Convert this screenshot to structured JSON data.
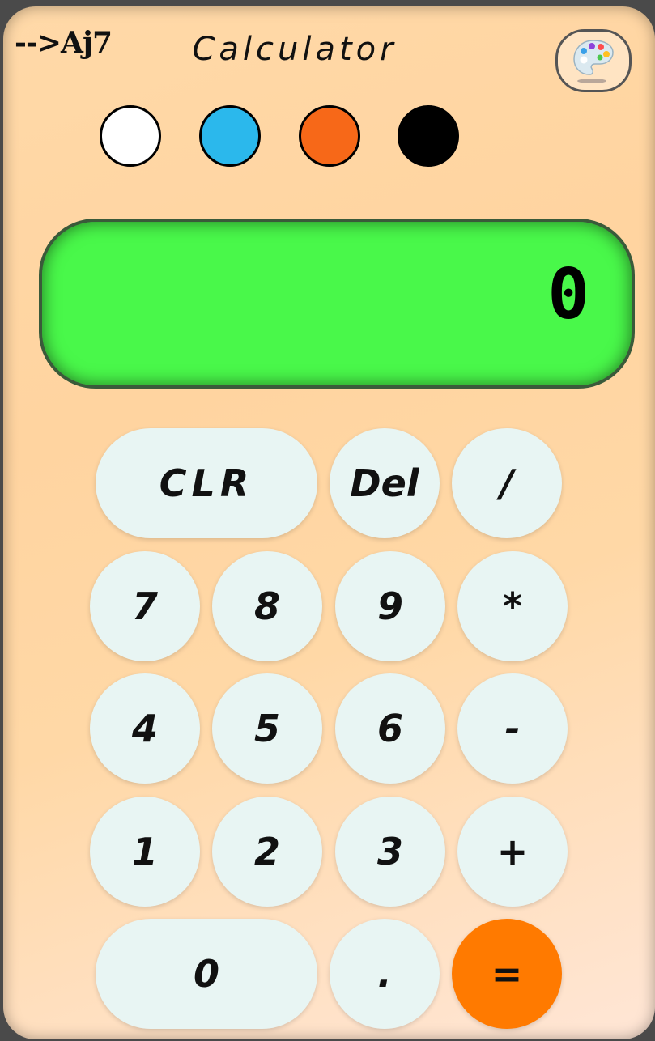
{
  "header": {
    "brand": "-->Aj7",
    "title": "Calculator",
    "palette_icon": "palette-icon"
  },
  "theme_swatches": [
    {
      "name": "white",
      "color": "#ffffff"
    },
    {
      "name": "blue",
      "color": "#2bb8ec"
    },
    {
      "name": "orange",
      "color": "#f76818"
    },
    {
      "name": "black",
      "color": "#000000"
    }
  ],
  "display": {
    "value": "0",
    "color": "#49f84a"
  },
  "keys": {
    "clr": "CLR",
    "del": "Del",
    "divide": "/",
    "seven": "7",
    "eight": "8",
    "nine": "9",
    "multiply": "*",
    "four": "4",
    "five": "5",
    "six": "6",
    "minus": "-",
    "one": "1",
    "two": "2",
    "three": "3",
    "plus": "+",
    "zero": "0",
    "dot": ".",
    "equals": "="
  },
  "colors": {
    "key_bg": "#e8f5f3",
    "equals_bg": "#ff7a00"
  }
}
